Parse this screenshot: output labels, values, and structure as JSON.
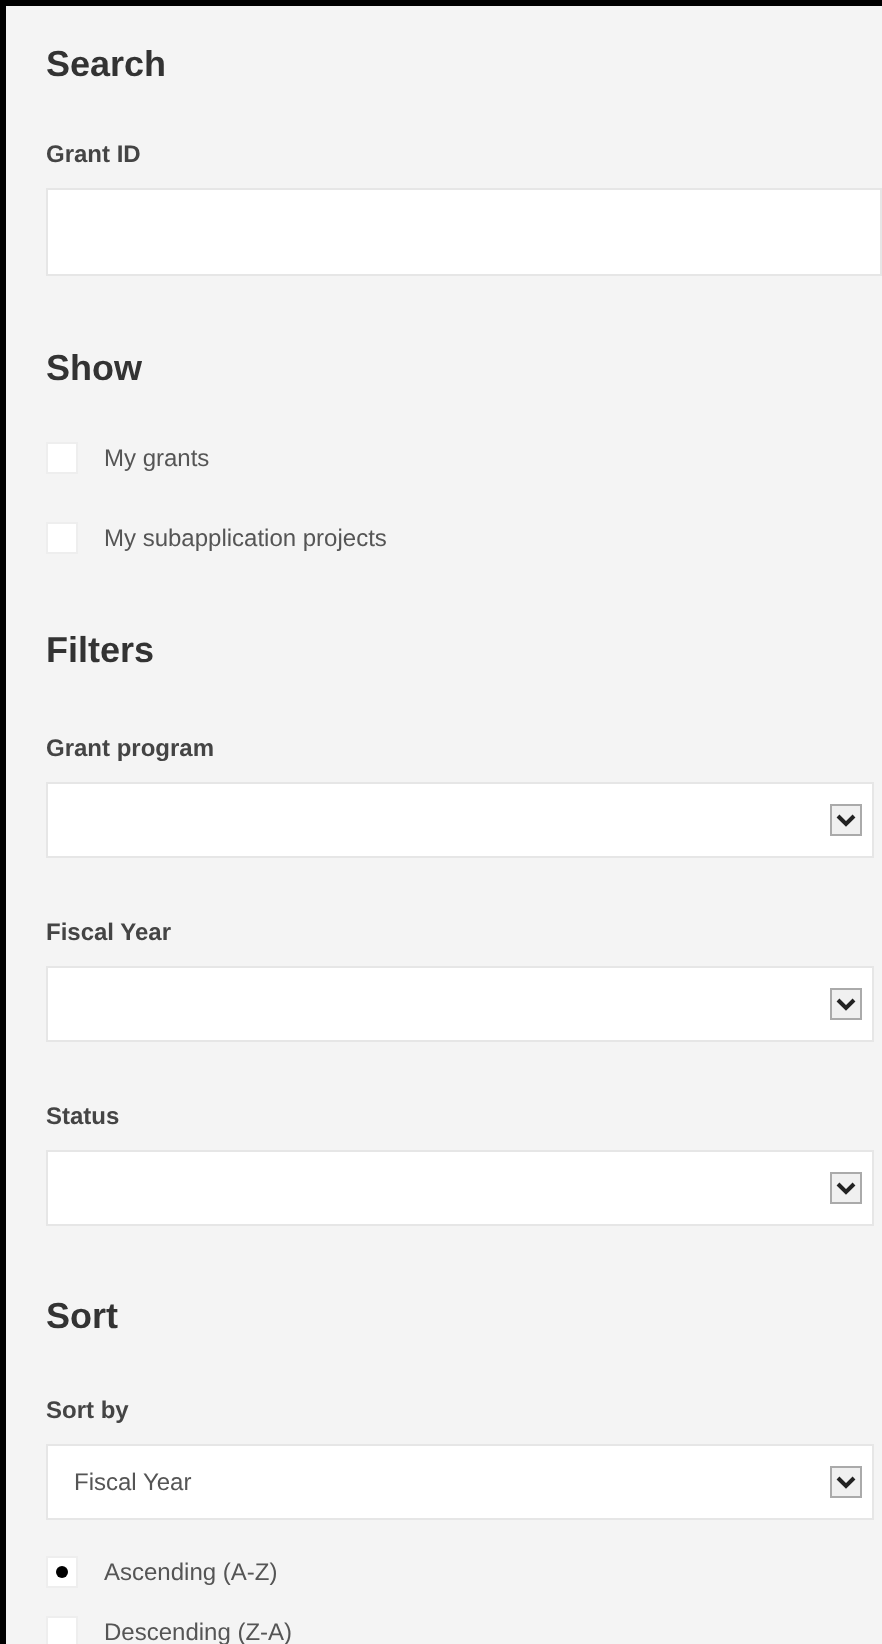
{
  "search": {
    "heading": "Search",
    "grant_id": {
      "label": "Grant ID"
    }
  },
  "show": {
    "heading": "Show",
    "options": [
      {
        "label": "My grants",
        "checked": false
      },
      {
        "label": "My subapplication projects",
        "checked": false
      }
    ]
  },
  "filters": {
    "heading": "Filters",
    "selects": [
      {
        "label": "Grant program"
      },
      {
        "label": "Fiscal Year"
      },
      {
        "label": "Status"
      }
    ]
  },
  "sort": {
    "heading": "Sort",
    "sort_by": {
      "label": "Sort by",
      "value": "Fiscal Year"
    },
    "order": [
      {
        "label": "Ascending (A-Z)",
        "selected": true
      },
      {
        "label": "Descending (Z-A)",
        "selected": false
      }
    ]
  }
}
